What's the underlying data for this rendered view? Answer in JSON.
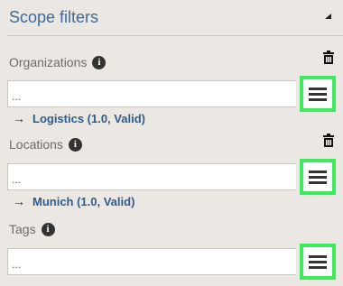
{
  "header": {
    "title": "Scope filters"
  },
  "sections": [
    {
      "label": "Organizations",
      "field_value": "...",
      "selected": "Logistics (1.0, Valid)"
    },
    {
      "label": "Locations",
      "field_value": "...",
      "selected": "Munich (1.0, Valid)"
    },
    {
      "label": "Tags",
      "field_value": "...",
      "selected": ""
    }
  ],
  "icons": {
    "collapse": "triangle-icon",
    "info": "info-icon",
    "delete": "trash-icon",
    "menu": "hamburger-menu-icon",
    "selected_arrow": "arrow-right-icon"
  },
  "colors": {
    "background": "#ebe7e2",
    "title": "#3d6a9a",
    "link": "#2d5c8c",
    "highlight": "#3dec5c"
  }
}
